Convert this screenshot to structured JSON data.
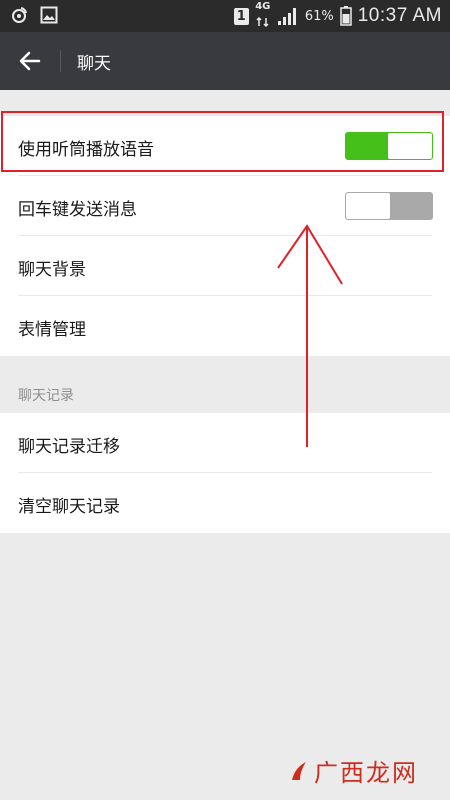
{
  "status_bar": {
    "sim": "1",
    "network": "4G",
    "battery": "61%",
    "time": "10:37 AM"
  },
  "header": {
    "title": "聊天"
  },
  "settings": {
    "group1": [
      {
        "label": "使用听筒播放语音",
        "toggle": true
      },
      {
        "label": "回车键发送消息",
        "toggle": false
      },
      {
        "label": "聊天背景"
      },
      {
        "label": "表情管理"
      }
    ],
    "section_title": "聊天记录",
    "group2": [
      {
        "label": "聊天记录迁移"
      },
      {
        "label": "清空聊天记录"
      }
    ]
  },
  "colors": {
    "toggle_on": "#45c01a",
    "annotation": "#e0202a",
    "header_bg": "#393a3f"
  },
  "watermark": {
    "text": "广西龙网"
  }
}
